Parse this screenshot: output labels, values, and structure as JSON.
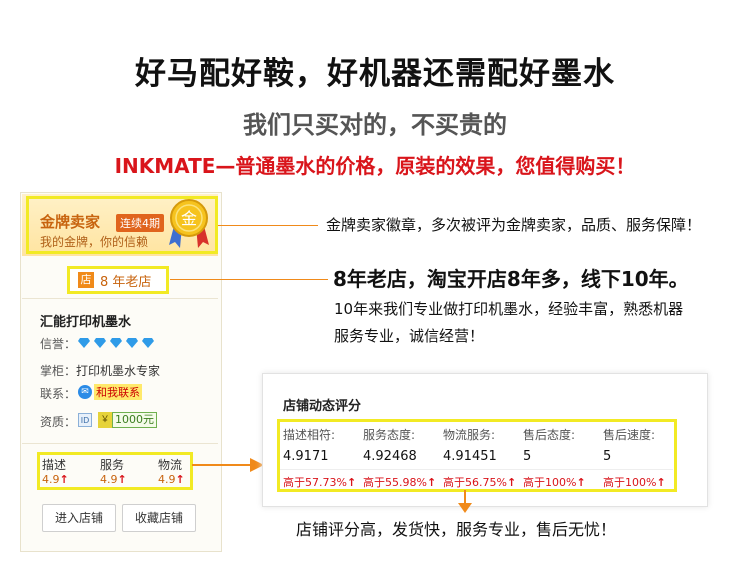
{
  "banner": {
    "headline": "好马配好鞍，好机器还需配好墨水",
    "subhead": "我们只买对的，不买贵的",
    "tagline": "INKMATE—普通墨水的价格，原装的效果，您值得购买！"
  },
  "shop_card": {
    "gold_seller": {
      "title": "金牌卖家",
      "badge": "连续4期",
      "note": "我的金牌，你的信赖",
      "medal_char": "金"
    },
    "store_age": {
      "icon_char": "店",
      "text": "8 年老店"
    },
    "shop_name": "汇能打印机墨水",
    "credit": {
      "label": "信誉：",
      "diamonds": 5
    },
    "owner": {
      "label": "掌柜：",
      "value": "打印机墨水专家"
    },
    "contact": {
      "label": "联系：",
      "text": "和我联系"
    },
    "qualification": {
      "label": "资质：",
      "deposit": "1000元"
    },
    "ratings": [
      {
        "label": "描述",
        "value": "4.9"
      },
      {
        "label": "服务",
        "value": "4.9"
      },
      {
        "label": "物流",
        "value": "4.9"
      }
    ],
    "buttons": {
      "enter": "进入店铺",
      "favorite": "收藏店铺"
    }
  },
  "callouts": {
    "gold": "金牌卖家徽章，多次被评为金牌卖家，品质、服务保障！",
    "age": "8年老店，淘宝开店8年多，线下10年。",
    "experience_1": "10年来我们专业做打印机墨水，经验丰富，熟悉机器",
    "experience_2": "服务专业，诚信经营！",
    "bottom": "店铺评分高，发货快，服务专业，售后无忧！"
  },
  "dynamic_ratings": {
    "title": "店铺动态评分",
    "columns": [
      {
        "header": "描述相符:",
        "value": "4.9171",
        "pct": "高于57.73%"
      },
      {
        "header": "服务态度:",
        "value": "4.92468",
        "pct": "高于55.98%"
      },
      {
        "header": "物流服务:",
        "value": "4.91451",
        "pct": "高于56.75%"
      },
      {
        "header": "售后态度:",
        "value": "5",
        "pct": "高于100%"
      },
      {
        "header": "售后速度:",
        "value": "5",
        "pct": "高于100%"
      }
    ]
  },
  "colors": {
    "highlight_border": "#f2ea24",
    "accent_red": "#d9151b",
    "connector_orange": "#f08a1a",
    "diamond_blue": "#2f9be8"
  }
}
